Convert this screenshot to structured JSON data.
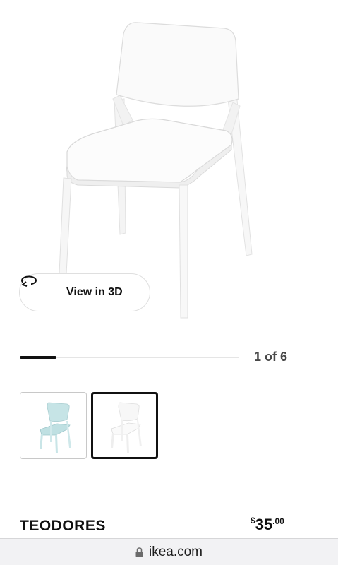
{
  "gallery": {
    "view3d_label": "View in 3D",
    "counter": "1 of 6",
    "progress_fraction": 0.167,
    "thumbnails": [
      {
        "color": "light-blue",
        "selected": false
      },
      {
        "color": "white",
        "selected": true
      }
    ]
  },
  "product": {
    "name": "TEODORES",
    "price": {
      "currency": "$",
      "integer": "35",
      "decimal": ".00"
    }
  },
  "browser": {
    "url": "ikea.com",
    "lock_icon": "lock-icon"
  },
  "colors": {
    "text": "#111111",
    "thumb_blue": "#bfe0e2",
    "url_bar": "#f2f2f4"
  }
}
